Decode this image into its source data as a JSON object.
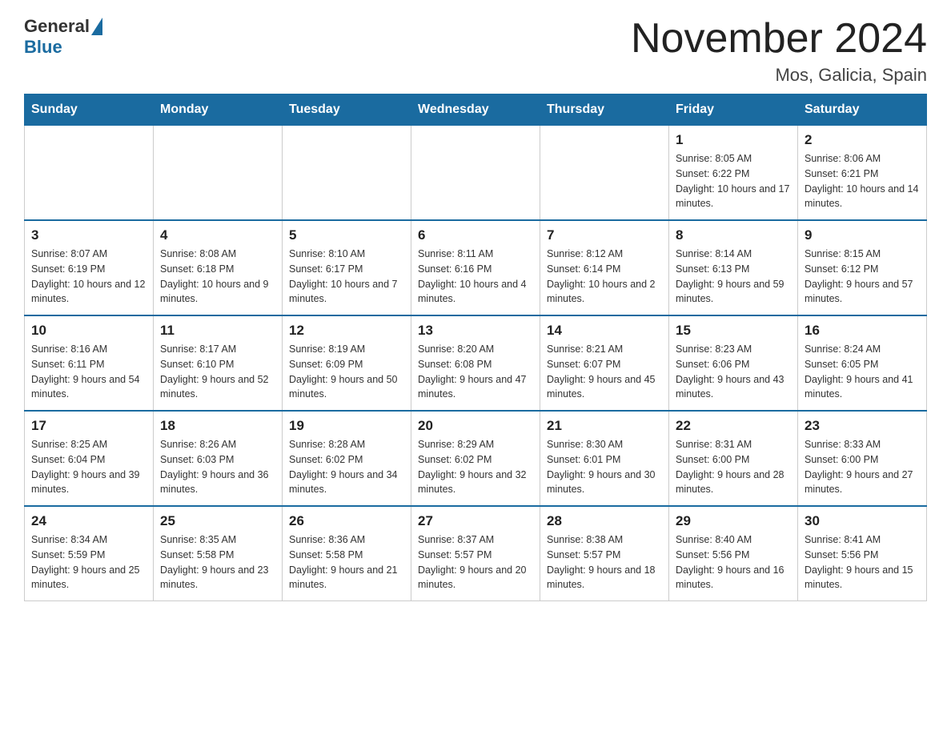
{
  "logo": {
    "general": "General",
    "blue": "Blue",
    "triangle": "▶"
  },
  "header": {
    "title": "November 2024",
    "location": "Mos, Galicia, Spain"
  },
  "weekdays": [
    "Sunday",
    "Monday",
    "Tuesday",
    "Wednesday",
    "Thursday",
    "Friday",
    "Saturday"
  ],
  "weeks": [
    [
      {
        "day": "",
        "sunrise": "",
        "sunset": "",
        "daylight": ""
      },
      {
        "day": "",
        "sunrise": "",
        "sunset": "",
        "daylight": ""
      },
      {
        "day": "",
        "sunrise": "",
        "sunset": "",
        "daylight": ""
      },
      {
        "day": "",
        "sunrise": "",
        "sunset": "",
        "daylight": ""
      },
      {
        "day": "",
        "sunrise": "",
        "sunset": "",
        "daylight": ""
      },
      {
        "day": "1",
        "sunrise": "Sunrise: 8:05 AM",
        "sunset": "Sunset: 6:22 PM",
        "daylight": "Daylight: 10 hours and 17 minutes."
      },
      {
        "day": "2",
        "sunrise": "Sunrise: 8:06 AM",
        "sunset": "Sunset: 6:21 PM",
        "daylight": "Daylight: 10 hours and 14 minutes."
      }
    ],
    [
      {
        "day": "3",
        "sunrise": "Sunrise: 8:07 AM",
        "sunset": "Sunset: 6:19 PM",
        "daylight": "Daylight: 10 hours and 12 minutes."
      },
      {
        "day": "4",
        "sunrise": "Sunrise: 8:08 AM",
        "sunset": "Sunset: 6:18 PM",
        "daylight": "Daylight: 10 hours and 9 minutes."
      },
      {
        "day": "5",
        "sunrise": "Sunrise: 8:10 AM",
        "sunset": "Sunset: 6:17 PM",
        "daylight": "Daylight: 10 hours and 7 minutes."
      },
      {
        "day": "6",
        "sunrise": "Sunrise: 8:11 AM",
        "sunset": "Sunset: 6:16 PM",
        "daylight": "Daylight: 10 hours and 4 minutes."
      },
      {
        "day": "7",
        "sunrise": "Sunrise: 8:12 AM",
        "sunset": "Sunset: 6:14 PM",
        "daylight": "Daylight: 10 hours and 2 minutes."
      },
      {
        "day": "8",
        "sunrise": "Sunrise: 8:14 AM",
        "sunset": "Sunset: 6:13 PM",
        "daylight": "Daylight: 9 hours and 59 minutes."
      },
      {
        "day": "9",
        "sunrise": "Sunrise: 8:15 AM",
        "sunset": "Sunset: 6:12 PM",
        "daylight": "Daylight: 9 hours and 57 minutes."
      }
    ],
    [
      {
        "day": "10",
        "sunrise": "Sunrise: 8:16 AM",
        "sunset": "Sunset: 6:11 PM",
        "daylight": "Daylight: 9 hours and 54 minutes."
      },
      {
        "day": "11",
        "sunrise": "Sunrise: 8:17 AM",
        "sunset": "Sunset: 6:10 PM",
        "daylight": "Daylight: 9 hours and 52 minutes."
      },
      {
        "day": "12",
        "sunrise": "Sunrise: 8:19 AM",
        "sunset": "Sunset: 6:09 PM",
        "daylight": "Daylight: 9 hours and 50 minutes."
      },
      {
        "day": "13",
        "sunrise": "Sunrise: 8:20 AM",
        "sunset": "Sunset: 6:08 PM",
        "daylight": "Daylight: 9 hours and 47 minutes."
      },
      {
        "day": "14",
        "sunrise": "Sunrise: 8:21 AM",
        "sunset": "Sunset: 6:07 PM",
        "daylight": "Daylight: 9 hours and 45 minutes."
      },
      {
        "day": "15",
        "sunrise": "Sunrise: 8:23 AM",
        "sunset": "Sunset: 6:06 PM",
        "daylight": "Daylight: 9 hours and 43 minutes."
      },
      {
        "day": "16",
        "sunrise": "Sunrise: 8:24 AM",
        "sunset": "Sunset: 6:05 PM",
        "daylight": "Daylight: 9 hours and 41 minutes."
      }
    ],
    [
      {
        "day": "17",
        "sunrise": "Sunrise: 8:25 AM",
        "sunset": "Sunset: 6:04 PM",
        "daylight": "Daylight: 9 hours and 39 minutes."
      },
      {
        "day": "18",
        "sunrise": "Sunrise: 8:26 AM",
        "sunset": "Sunset: 6:03 PM",
        "daylight": "Daylight: 9 hours and 36 minutes."
      },
      {
        "day": "19",
        "sunrise": "Sunrise: 8:28 AM",
        "sunset": "Sunset: 6:02 PM",
        "daylight": "Daylight: 9 hours and 34 minutes."
      },
      {
        "day": "20",
        "sunrise": "Sunrise: 8:29 AM",
        "sunset": "Sunset: 6:02 PM",
        "daylight": "Daylight: 9 hours and 32 minutes."
      },
      {
        "day": "21",
        "sunrise": "Sunrise: 8:30 AM",
        "sunset": "Sunset: 6:01 PM",
        "daylight": "Daylight: 9 hours and 30 minutes."
      },
      {
        "day": "22",
        "sunrise": "Sunrise: 8:31 AM",
        "sunset": "Sunset: 6:00 PM",
        "daylight": "Daylight: 9 hours and 28 minutes."
      },
      {
        "day": "23",
        "sunrise": "Sunrise: 8:33 AM",
        "sunset": "Sunset: 6:00 PM",
        "daylight": "Daylight: 9 hours and 27 minutes."
      }
    ],
    [
      {
        "day": "24",
        "sunrise": "Sunrise: 8:34 AM",
        "sunset": "Sunset: 5:59 PM",
        "daylight": "Daylight: 9 hours and 25 minutes."
      },
      {
        "day": "25",
        "sunrise": "Sunrise: 8:35 AM",
        "sunset": "Sunset: 5:58 PM",
        "daylight": "Daylight: 9 hours and 23 minutes."
      },
      {
        "day": "26",
        "sunrise": "Sunrise: 8:36 AM",
        "sunset": "Sunset: 5:58 PM",
        "daylight": "Daylight: 9 hours and 21 minutes."
      },
      {
        "day": "27",
        "sunrise": "Sunrise: 8:37 AM",
        "sunset": "Sunset: 5:57 PM",
        "daylight": "Daylight: 9 hours and 20 minutes."
      },
      {
        "day": "28",
        "sunrise": "Sunrise: 8:38 AM",
        "sunset": "Sunset: 5:57 PM",
        "daylight": "Daylight: 9 hours and 18 minutes."
      },
      {
        "day": "29",
        "sunrise": "Sunrise: 8:40 AM",
        "sunset": "Sunset: 5:56 PM",
        "daylight": "Daylight: 9 hours and 16 minutes."
      },
      {
        "day": "30",
        "sunrise": "Sunrise: 8:41 AM",
        "sunset": "Sunset: 5:56 PM",
        "daylight": "Daylight: 9 hours and 15 minutes."
      }
    ]
  ]
}
